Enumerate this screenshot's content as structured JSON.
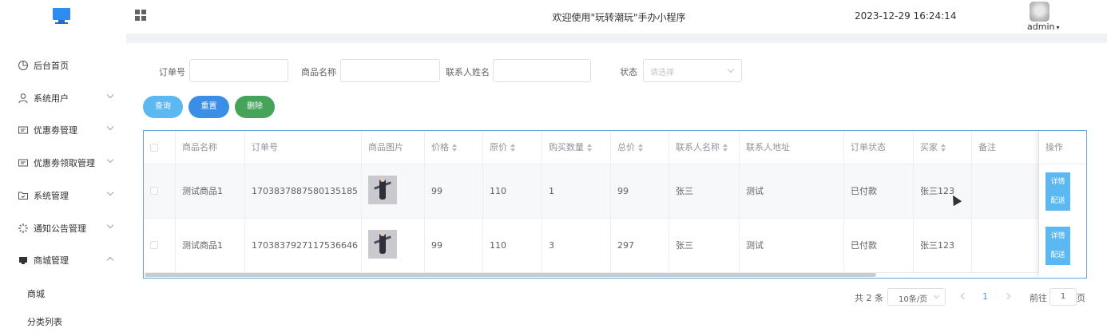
{
  "header": {
    "title": "欢迎使用\"玩转潮玩\"手办小程序",
    "datetime": "2023-12-29 16:24:14",
    "user": "admin"
  },
  "sidebar": {
    "items": [
      {
        "label": "后台首页",
        "icon": "pie-chart-icon",
        "arrow": ""
      },
      {
        "label": "系统用户",
        "icon": "user-icon",
        "arrow": "down"
      },
      {
        "label": "优惠劵管理",
        "icon": "ticket-icon",
        "arrow": "down"
      },
      {
        "label": "优惠劵领取管理",
        "icon": "ticket-icon",
        "arrow": "down"
      },
      {
        "label": "系统管理",
        "icon": "folder-icon",
        "arrow": "down"
      },
      {
        "label": "通知公告管理",
        "icon": "loading-icon",
        "arrow": "down"
      },
      {
        "label": "商城管理",
        "icon": "monitor-icon",
        "arrow": "up"
      }
    ],
    "subitems": [
      "商城",
      "分类列表"
    ]
  },
  "filters": {
    "order_no_label": "订单号",
    "product_name_label": "商品名称",
    "contact_name_label": "联系人姓名",
    "status_label": "状态",
    "status_placeholder": "请选择"
  },
  "buttons": {
    "query": "查询",
    "reset": "重置",
    "delete": "删除"
  },
  "table": {
    "columns": [
      "商品名称",
      "订单号",
      "商品图片",
      "价格",
      "原价",
      "购买数量",
      "总价",
      "联系人名称",
      "联系人地址",
      "订单状态",
      "买家",
      "备注",
      "操作"
    ],
    "rows": [
      {
        "name": "测试商品1",
        "order_no": "1703837887580135185",
        "price": "99",
        "orig": "110",
        "qty": "1",
        "total": "99",
        "contact": "张三",
        "address": "测试",
        "status": "已付款",
        "buyer": "张三123",
        "remark": ""
      },
      {
        "name": "测试商品1",
        "order_no": "1703837927117536646",
        "price": "99",
        "orig": "110",
        "qty": "3",
        "total": "297",
        "contact": "张三",
        "address": "测试",
        "status": "已付款",
        "buyer": "张三123",
        "remark": ""
      }
    ],
    "op_detail": "详情",
    "op_ship": "配送"
  },
  "pagination": {
    "total": "共 2 条",
    "page_size": "10条/页",
    "current": "1",
    "goto": "前往",
    "goto_value": "1",
    "page_unit": "页"
  }
}
